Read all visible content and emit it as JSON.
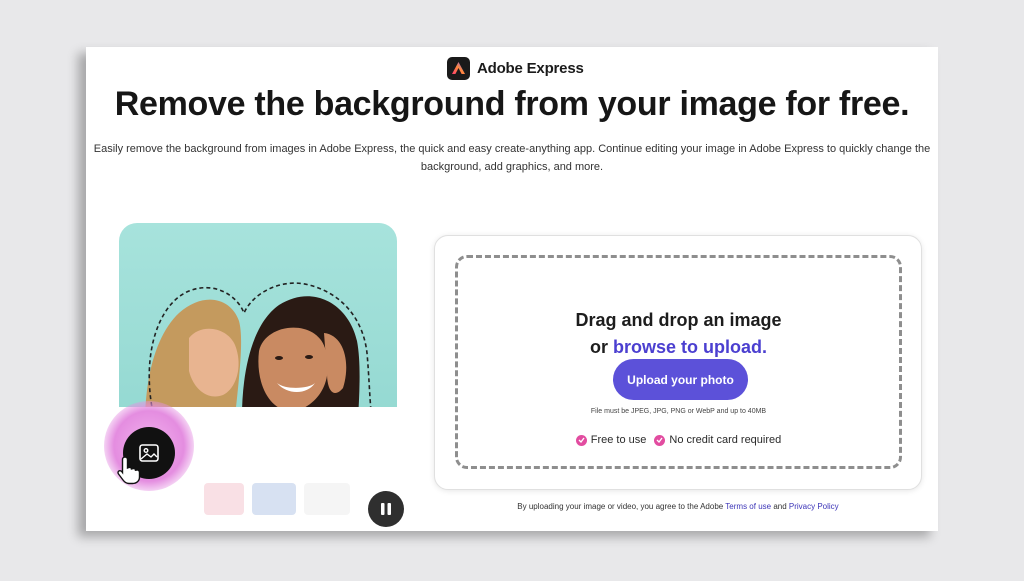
{
  "brand": {
    "name": "Adobe Express",
    "icon": "adobe-express-logo"
  },
  "headline": "Remove the background from your image for free.",
  "subtext": {
    "line1": "Easily remove the background from images in Adobe Express, the quick and easy create-anything app. Continue editing your image in Adobe Express to quickly change the",
    "line2": "background, add graphics, and more."
  },
  "upload": {
    "drag_text": "Drag and drop an image",
    "or_text": "or ",
    "browse_text": "browse to upload.",
    "button_label": "Upload your photo",
    "file_note": "File must be JPEG, JPG, PNG or WebP and up to 40MB",
    "perks": [
      "Free to use",
      "No credit card required"
    ]
  },
  "legal": {
    "prefix": "By uploading your image or video, you agree to the Adobe ",
    "terms": "Terms of use",
    "and": " and ",
    "privacy": "Privacy Policy"
  },
  "colors": {
    "accent": "#5c51d9",
    "link": "#4b3fd0",
    "check": "#e24ca0",
    "photo_bg": "#a7e3dc"
  },
  "icons": [
    "image-icon",
    "pause-icon",
    "cursor-hand-icon",
    "check-icon"
  ]
}
